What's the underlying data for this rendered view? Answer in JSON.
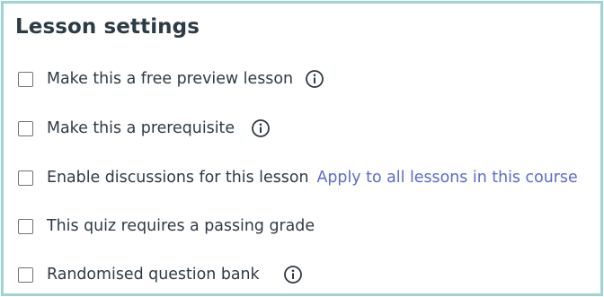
{
  "panel": {
    "title": "Lesson settings"
  },
  "settings": [
    {
      "label": "Make this a free preview lesson",
      "checked": false,
      "info_icon": "info-circle-icon"
    },
    {
      "label": "Make this a prerequisite",
      "checked": false,
      "info_icon": "info-circle-icon"
    },
    {
      "label": "Enable discussions for this lesson",
      "checked": false,
      "link": "Apply to all lessons in this course"
    },
    {
      "label": "This quiz requires a passing grade",
      "checked": false
    },
    {
      "label": "Randomised question bank",
      "checked": false,
      "info_icon": "info-circle-icon"
    }
  ],
  "colors": {
    "border": "#9ed5d4",
    "text": "#2d3b45",
    "link": "#5b6bcf",
    "checkbox_border": "#6c757c"
  }
}
